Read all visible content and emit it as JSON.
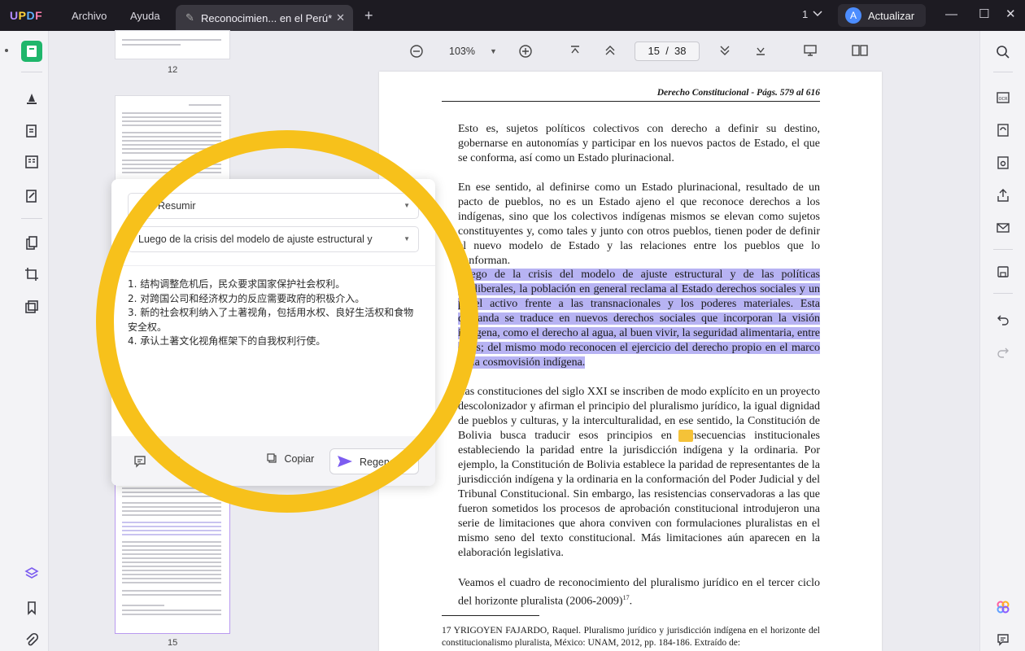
{
  "titlebar": {
    "logo": {
      "u": "U",
      "p": "P",
      "d": "D",
      "f": "F"
    },
    "menu": {
      "file": "Archivo",
      "help": "Ayuda"
    },
    "tab_title": "Reconocimien... en el Perú*",
    "window_count": "1",
    "update_avatar": "A",
    "update_label": "Actualizar"
  },
  "toolbar": {
    "zoom": "103%",
    "page_current": "15",
    "page_sep": "/",
    "page_total": "38"
  },
  "thumbnails": {
    "page_12": "12",
    "page_15": "15"
  },
  "popup": {
    "mode": "Resumir",
    "source": "Luego de la crisis del modelo de ajuste estructural y",
    "result": [
      "1. 结构调整危机后，民众要求国家保护社会权利。",
      "2. 对跨国公司和经济权力的反应需要政府的积极介入。",
      "3. 新的社会权利纳入了土著视角，包括用水权、良好生活权和食物安全权。",
      "4. 承认土著文化视角框架下的自我权利行使。"
    ],
    "copy_label": "Copiar",
    "regen_label": "Regenerar"
  },
  "document": {
    "running_head": "Derecho Constitucional - Págs. 579 al 616",
    "p1": "Esto es, sujetos políticos colectivos con derecho a definir su destino, gobernarse en autonomías y participar en los nuevos pactos de Estado, el que se conforma, así como un Estado plurinacional.",
    "p2": "En ese sentido, al definirse como un Estado plurinacional, resultado de un pacto de pueblos, no es un Estado ajeno el que reconoce derechos a los indígenas, sino que los colectivos indígenas mismos se elevan como sujetos constituyentes y, como tales y junto con otros pueblos, tienen poder de definir el nuevo modelo de Estado y las relaciones entre los pueblos que lo conforman.",
    "p3": "Luego de la crisis del modelo de ajuste estructural y de las políticas neoliberales, la población en general reclama al Estado derechos sociales y un papel activo frente a las transnacionales y los poderes materiales. Esta demanda se traduce en nuevos derechos sociales que incorporan la visión indígena, como el derecho al agua, al buen vivir, la seguridad alimentaria, entre otros; del mismo modo reconocen el ejercicio del derecho propio en el marco de la cosmovisión indígena.",
    "p4": "Las constituciones del siglo XXI se inscriben de modo explícito en un proyecto descolonizador y afirman el principio del pluralismo jurídico, la igual dignidad de pueblos y culturas, y la interculturalidad, en ese sentido, la Constitución de Bolivia busca traducir esos principios en consecuencias institucionales estableciendo la paridad entre la jurisdicción indígena y la ordinaria. Por ejemplo, la Constitución de Bolivia establece la paridad de representantes de la jurisdicción indígena y la ordinaria en la conformación del Poder Judicial y del Tribunal Constitucional. Sin embargo, las resistencias conservadoras a las que fueron sometidos los procesos de aprobación constitucional introdujeron una serie de limitaciones que ahora conviven con formulaciones pluralistas en el mismo seno del texto constitucional. Más limitaciones aún aparecen en la elaboración legislativa.",
    "p5": "Veamos el cuadro de reconocimiento del pluralismo jurídico en el tercer ciclo del horizonte pluralista (2006-2009)",
    "p5_sup": "17",
    "p5_end": ".",
    "footnote": "17   YRIGOYEN FAJARDO, Raquel. Pluralismo jurídico y jurisdicción indígena en el horizonte del constitucionalismo pluralista, México: UNAM, 2012, pp. 184-186. Extraído de:"
  },
  "colors": {
    "accent": "#7c5cf0",
    "highlight": "#b7b3f3",
    "ring": "#f7c11b",
    "titlebar": "#1d1b22"
  }
}
